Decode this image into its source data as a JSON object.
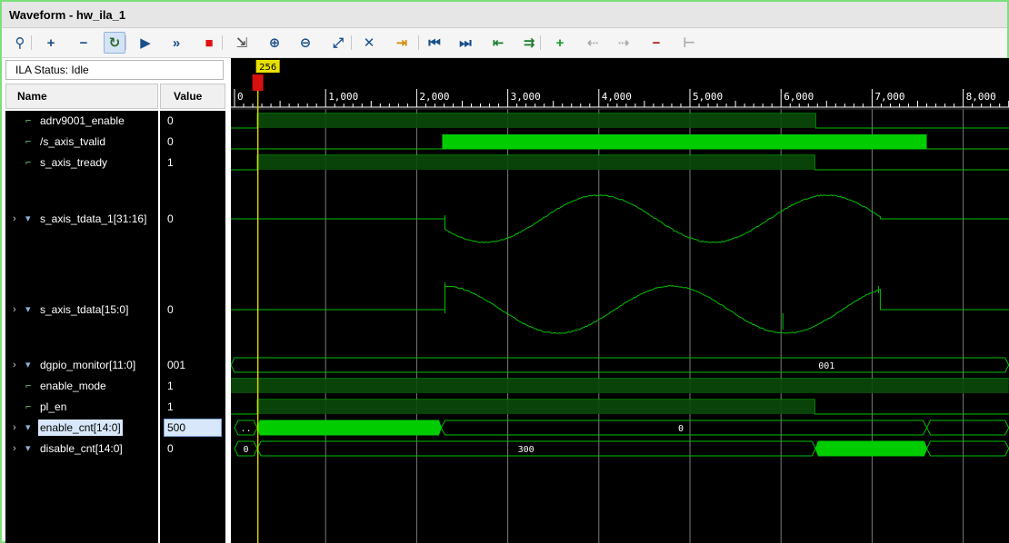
{
  "window": {
    "title": "Waveform - hw_ila_1"
  },
  "toolbar": {
    "buttons": [
      {
        "name": "search-button",
        "icon": "search-icon",
        "glyph": "⚲"
      },
      {
        "name": "add-button",
        "icon": "plus-icon",
        "glyph": "+"
      },
      {
        "name": "remove-button",
        "icon": "minus-icon",
        "glyph": "−"
      },
      {
        "name": "auto-retrigger-button",
        "icon": "refresh-icon",
        "glyph": "↻"
      },
      {
        "name": "run-trigger-button",
        "icon": "play-icon",
        "glyph": "▶"
      },
      {
        "name": "run-immediate-button",
        "icon": "fast-forward-icon",
        "glyph": "»"
      },
      {
        "name": "stop-trigger-button",
        "icon": "stop-icon",
        "glyph": "■"
      },
      {
        "name": "export-button",
        "icon": "export-icon",
        "glyph": "⇲"
      },
      {
        "name": "zoom-in-button",
        "icon": "zoom-in-icon",
        "glyph": "⊕"
      },
      {
        "name": "zoom-out-button",
        "icon": "zoom-out-icon",
        "glyph": "⊖"
      },
      {
        "name": "zoom-fit-button",
        "icon": "zoom-fit-icon",
        "glyph": "⤢"
      },
      {
        "name": "cursor-button",
        "icon": "cursor-icon",
        "glyph": "✕"
      },
      {
        "name": "go-to-cursor-button",
        "icon": "go-to-cursor-icon",
        "glyph": "⇥"
      },
      {
        "name": "go-to-start-button",
        "icon": "go-to-start-icon",
        "glyph": "⏮"
      },
      {
        "name": "go-to-end-button",
        "icon": "go-to-end-icon",
        "glyph": "⏭"
      },
      {
        "name": "prev-transition-button",
        "icon": "prev-transition-icon",
        "glyph": "⇤"
      },
      {
        "name": "next-transition-button",
        "icon": "next-transition-icon",
        "glyph": "⇉"
      },
      {
        "name": "add-marker-button",
        "icon": "add-marker-icon",
        "glyph": "+"
      },
      {
        "name": "prev-marker-button",
        "icon": "prev-marker-icon",
        "glyph": "⇠"
      },
      {
        "name": "next-marker-button",
        "icon": "next-marker-icon",
        "glyph": "⇢"
      },
      {
        "name": "delete-marker-button",
        "icon": "delete-marker-icon",
        "glyph": "−"
      },
      {
        "name": "swap-cursors-button",
        "icon": "swap-cursors-icon",
        "glyph": "⊢"
      }
    ]
  },
  "status": {
    "text": "ILA Status: Idle"
  },
  "columns": {
    "name": "Name",
    "value": "Value"
  },
  "timeline": {
    "ticks": [
      "0",
      "1,000",
      "2,000",
      "3,000",
      "4,000",
      "5,000",
      "6,000",
      "7,000",
      "8,000"
    ],
    "cursor_label": "256",
    "cursor_sample": 256
  },
  "signals": [
    {
      "name": "adrv9001_enable",
      "value": "0",
      "type": "bit",
      "expandable": false
    },
    {
      "name": "/s_axis_tvalid",
      "value": "0",
      "type": "bit",
      "expandable": false
    },
    {
      "name": "s_axis_tready",
      "value": "1",
      "type": "bit",
      "expandable": false
    },
    {
      "name": "s_axis_tdata_1[31:16]",
      "value": "0",
      "type": "bus",
      "expandable": true
    },
    {
      "name": "s_axis_tdata[15:0]",
      "value": "0",
      "type": "bus",
      "expandable": true
    },
    {
      "name": "dgpio_monitor[11:0]",
      "value": "001",
      "type": "bus",
      "expandable": true,
      "bus_label": "001"
    },
    {
      "name": "enable_mode",
      "value": "1",
      "type": "bit",
      "expandable": false
    },
    {
      "name": "pl_en",
      "value": "1",
      "type": "bit",
      "expandable": false
    },
    {
      "name": "enable_cnt[14:0]",
      "value": "500",
      "type": "bus",
      "expandable": true,
      "selected": true,
      "bus_labels": [
        "..",
        "0"
      ]
    },
    {
      "name": "disable_cnt[14:0]",
      "value": "0",
      "type": "bus",
      "expandable": true,
      "bus_labels": [
        "0",
        "300"
      ]
    }
  ],
  "colors": {
    "wave": "#00c000",
    "wave_bright": "#00cc00",
    "cursor": "#e0d000",
    "grid": "#7a7a7a",
    "background": "#000000"
  }
}
